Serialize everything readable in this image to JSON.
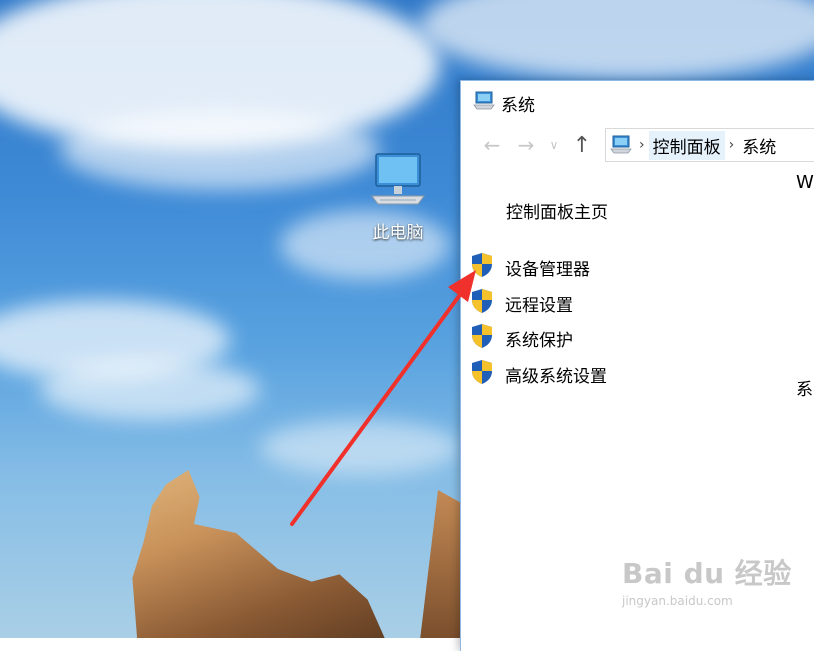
{
  "desktop": {
    "icon_label": "此电脑",
    "icon_name": "monitor-icon"
  },
  "window": {
    "title": "系统",
    "title_icon": "system-computer-icon",
    "nav": {
      "back_icon": "arrow-left-icon",
      "forward_icon": "arrow-right-icon",
      "recent_icon": "chevron-down-icon",
      "up_icon": "arrow-up-icon",
      "back_glyph": "←",
      "forward_glyph": "→",
      "recent_glyph": "∨",
      "up_glyph": "↑",
      "breadcrumb_sep": "›"
    },
    "address": {
      "crumbs": [
        "控制面板",
        "系统"
      ]
    },
    "side_fragment_top": "W",
    "side_fragment_mid": "系",
    "sidebar": {
      "home_link": "控制面板主页",
      "tasks": [
        {
          "label": "设备管理器",
          "icon": "uac-shield-icon"
        },
        {
          "label": "远程设置",
          "icon": "uac-shield-icon"
        },
        {
          "label": "系统保护",
          "icon": "uac-shield-icon"
        },
        {
          "label": "高级系统设置",
          "icon": "uac-shield-icon"
        }
      ]
    }
  },
  "annotation": {
    "arrow_color": "#f0302a"
  },
  "watermark": {
    "logo": "Bai du 经验",
    "url": "jingyan.baidu.com"
  }
}
